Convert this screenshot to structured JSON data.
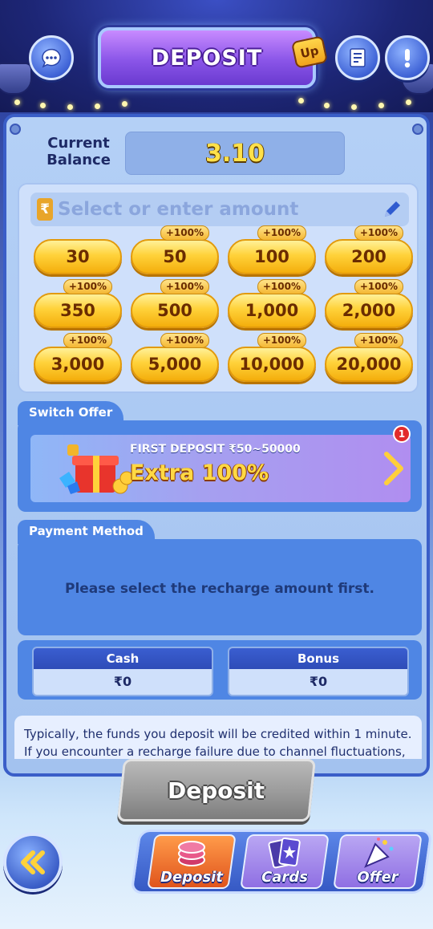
{
  "header": {
    "title": "DEPOSIT",
    "badge_text": "Up",
    "icons": [
      "support-chat-icon",
      "records-icon",
      "info-alert-icon"
    ]
  },
  "balance": {
    "label": "Current Balance",
    "value": "3.10"
  },
  "amount": {
    "currency_symbol": "₹",
    "placeholder": "Select or enter amount",
    "options": [
      {
        "value": "30",
        "bonus": ""
      },
      {
        "value": "50",
        "bonus": "+100%"
      },
      {
        "value": "100",
        "bonus": "+100%"
      },
      {
        "value": "200",
        "bonus": "+100%"
      },
      {
        "value": "350",
        "bonus": "+100%"
      },
      {
        "value": "500",
        "bonus": "+100%"
      },
      {
        "value": "1,000",
        "bonus": "+100%"
      },
      {
        "value": "2,000",
        "bonus": "+100%"
      },
      {
        "value": "3,000",
        "bonus": "+100%"
      },
      {
        "value": "5,000",
        "bonus": "+100%"
      },
      {
        "value": "10,000",
        "bonus": "+100%"
      },
      {
        "value": "20,000",
        "bonus": "+100%"
      }
    ]
  },
  "offer": {
    "section_title": "Switch Offer",
    "title": "FIRST DEPOSIT ₹50~50000",
    "extra": "Extra 100%",
    "badge_count": "1"
  },
  "payment": {
    "section_title": "Payment Method",
    "message": "Please select the recharge amount first."
  },
  "wallet": {
    "cash_label": "Cash",
    "cash_value": "₹0",
    "bonus_label": "Bonus",
    "bonus_value": "₹0"
  },
  "info_text": "Typically, the funds you deposit will be credited within 1 minute. If you encounter a recharge failure due to channel fluctuations, we",
  "deposit_button": "Deposit",
  "nav": {
    "items": [
      {
        "label": "Deposit",
        "active": true
      },
      {
        "label": "Cards",
        "active": false
      },
      {
        "label": "Offer",
        "active": false
      }
    ]
  },
  "colors": {
    "accent_gold": "#ffd23a",
    "panel_blue": "#4f86e4",
    "title_purple": "#8a55e8",
    "balance_yellow": "#ffe14a",
    "disabled_gray": "#9a9a9a"
  }
}
